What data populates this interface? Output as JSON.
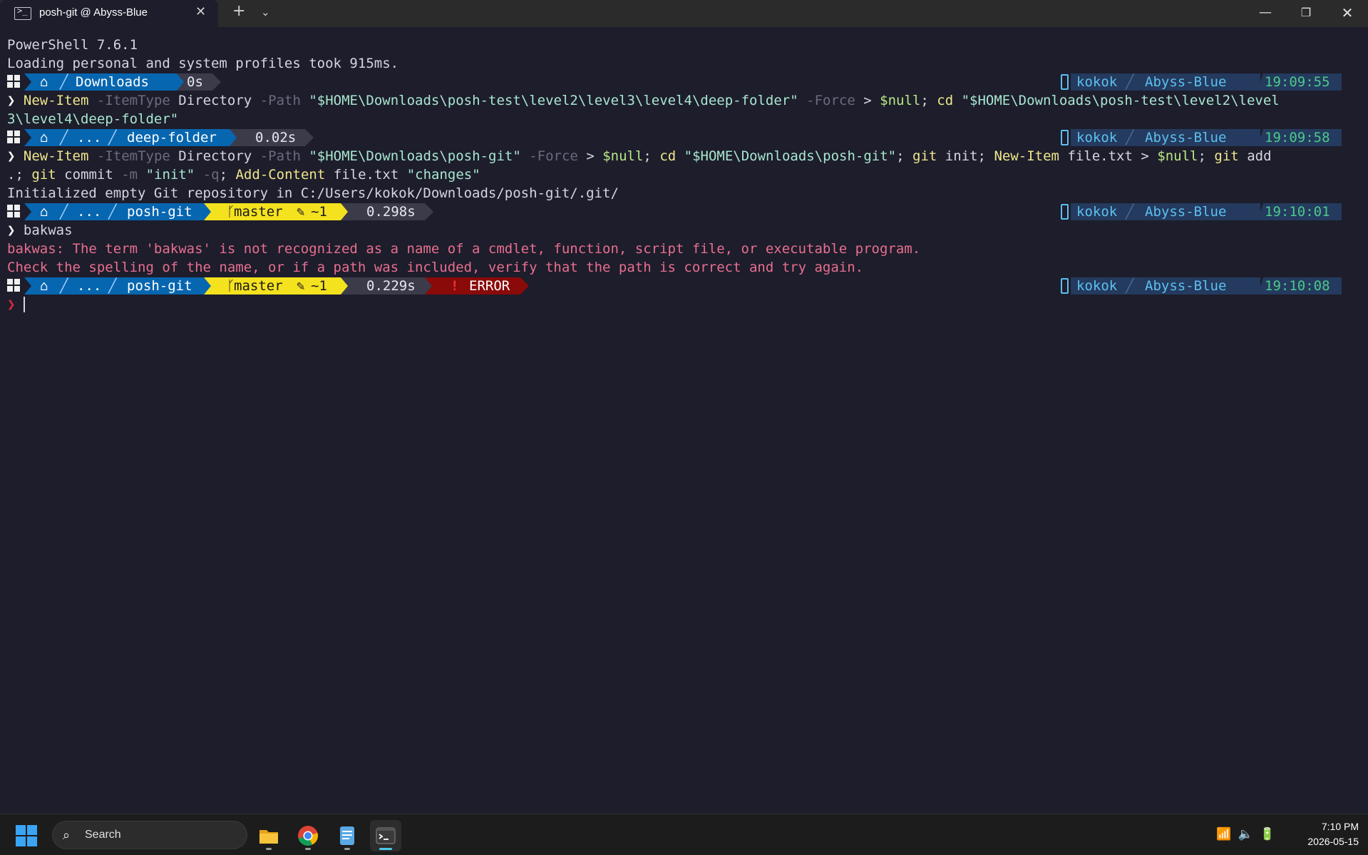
{
  "window": {
    "tab_title": "posh-git @ Abyss-Blue",
    "tab_icon": "powershell-icon",
    "new_tab_label": "+",
    "dropdown_label": "⌄",
    "min_label": "—",
    "restore_label": "❐",
    "close_label": "✕"
  },
  "terminal": {
    "banner": "PowerShell 7.6.1",
    "profile_msg": "Loading personal and system profiles took 915ms.",
    "prompts": [
      {
        "home_icon": "⌂",
        "path": "Downloads",
        "duration": "0s",
        "user": "kokok",
        "theme": "Abyss-Blue",
        "time": "19:09:55"
      },
      {
        "home_icon": "⌂",
        "ellipsis": "...",
        "path": "deep-folder",
        "duration": "0.02s",
        "user": "kokok",
        "theme": "Abyss-Blue",
        "time": "19:09:58"
      },
      {
        "home_icon": "⌂",
        "ellipsis": "...",
        "path": "posh-git",
        "branch": "master",
        "changes": "~1",
        "duration": "0.298s",
        "user": "kokok",
        "theme": "Abyss-Blue",
        "time": "19:10:01"
      },
      {
        "home_icon": "⌂",
        "ellipsis": "...",
        "path": "posh-git",
        "branch": "master",
        "changes": "~1",
        "duration": "0.229s",
        "status": "ERROR",
        "user": "kokok",
        "theme": "Abyss-Blue",
        "time": "19:10:08"
      }
    ],
    "cmd1": {
      "c1": "New-Item",
      "p1": "-ItemType",
      "a1": "Directory",
      "p2": "-Path",
      "s1": "\"$HOME\\Downloads\\posh-test\\level2\\level3\\level4\\deep-folder\"",
      "p3": "-Force",
      "o1": ">",
      "v1": "$null",
      "o2": ";",
      "c2": "cd",
      "s2": "\"$HOME\\Downloads\\posh-test\\level2\\level",
      "s3": "3\\level4\\deep-folder\""
    },
    "cmd2": {
      "c1": "New-Item",
      "p1": "-ItemType",
      "a1": "Directory",
      "p2": "-Path",
      "s1": "\"$HOME\\Downloads\\posh-git\"",
      "p3": "-Force",
      "o1": ">",
      "v1": "$null",
      "o2": ";",
      "c2": "cd",
      "s2": "\"$HOME\\Downloads\\posh-git\"",
      "o3": ";",
      "c3": "git",
      "a2": "init",
      "o4": ";",
      "c4": "New-Item",
      "a3": "file.txt",
      "o5": ">",
      "v2": "$null",
      "o6": ";",
      "c5": "git",
      "a4": "add",
      "a5": ".",
      "o7": ";",
      "c6": "git",
      "a6": "commit",
      "p4": "-m",
      "s3": "\"init\"",
      "p5": "-q",
      "o8": ";",
      "c7": "Add-Content",
      "a7": "file.txt",
      "s4": "\"changes\""
    },
    "git_init_output": "Initialized empty Git repository in C:/Users/kokok/Downloads/posh-git/.git/",
    "cmd3": "bakwas",
    "error_line1": "bakwas: The term 'bakwas' is not recognized as a name of a cmdlet, function, script file, or executable program.",
    "error_line2": "Check the spelling of the name, or if a path was included, verify that the path is correct and try again.",
    "chevron": "❯"
  },
  "taskbar": {
    "search_label": "Search",
    "apps": [
      "file-explorer-icon",
      "chrome-icon",
      "notepad-icon",
      "terminal-icon"
    ],
    "clock_time": "7:10 PM",
    "clock_date": "2026-05-15"
  },
  "colors": {
    "background": "#1d1d2b",
    "path_segment": "#0766b0",
    "git_segment": "#f5e21f",
    "error_segment": "#8a0a0a",
    "duration_segment": "#3b3b4a",
    "error_text": "#e86f8f"
  }
}
